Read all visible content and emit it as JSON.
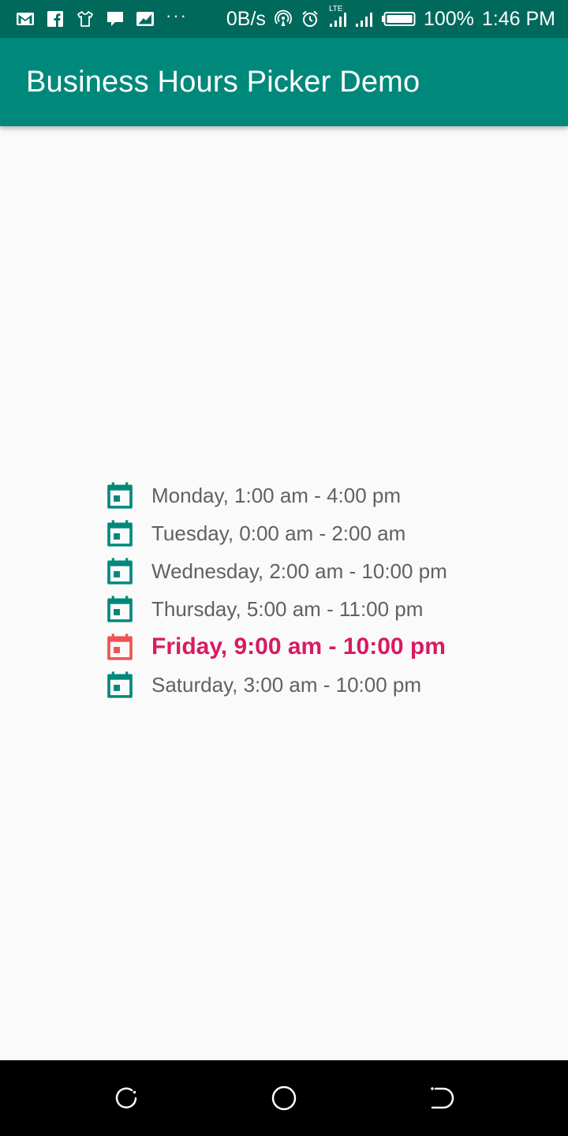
{
  "status_bar": {
    "network_speed": "0B/s",
    "battery": "100%",
    "time": "1:46 PM",
    "network_type": "LTE",
    "left_icons": [
      "gmail-icon",
      "facebook-icon",
      "shirt-icon",
      "chat-icon",
      "image-icon",
      "more-dots-icon"
    ],
    "right_icons": [
      "hotspot-icon",
      "alarm-icon",
      "signal-lte-icon",
      "signal-icon",
      "battery-icon"
    ]
  },
  "app_bar": {
    "title": "Business Hours Picker Demo",
    "color": "#00897b"
  },
  "hours": [
    {
      "text": "Monday, 1:00 am - 4:00 pm",
      "today": false
    },
    {
      "text": "Tuesday, 0:00 am - 2:00 am",
      "today": false
    },
    {
      "text": "Wednesday, 2:00 am - 10:00 pm",
      "today": false
    },
    {
      "text": "Thursday, 5:00 am - 11:00 pm",
      "today": false
    },
    {
      "text": "Friday, 9:00 am - 10:00 pm",
      "today": true
    },
    {
      "text": "Saturday, 3:00 am - 10:00 pm",
      "today": false
    }
  ],
  "colors": {
    "icon_default": "#00897b",
    "icon_today": "#ef5350",
    "text_today": "#d81b60",
    "text_default": "#616161"
  },
  "nav_bar": {
    "buttons": [
      "recent-apps-icon",
      "home-icon",
      "back-icon"
    ]
  }
}
